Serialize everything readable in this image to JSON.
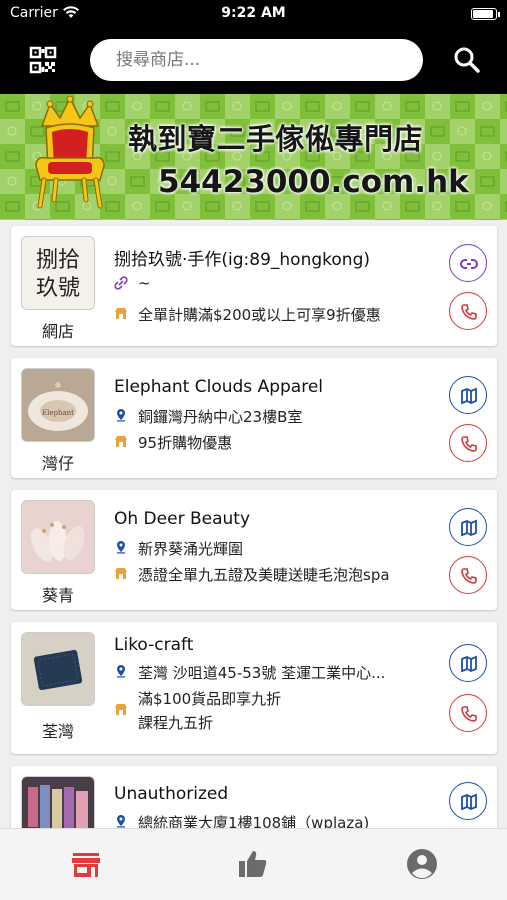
{
  "status_bar": {
    "carrier": "Carrier",
    "time": "9:22 AM",
    "battery_level": 1.0
  },
  "search": {
    "placeholder": "搜尋商店..."
  },
  "banner": {
    "title": "執到寶二手傢俬專門店",
    "url": "54423000.com.hk"
  },
  "shops": [
    {
      "name": "捌拾玖號·手作(ig:89_hongkong)",
      "district": "網店",
      "thumb_text": "捌拾玖號",
      "info_icon": "link-icon",
      "info": "~",
      "offer": "全單計購滿$200或以上可享9折優惠",
      "offer_line2": "",
      "action1": "link-icon"
    },
    {
      "name": "Elephant Clouds Apparel",
      "district": "灣仔",
      "thumb_text": "",
      "info_icon": "location-icon",
      "info": "銅鑼灣丹納中心23樓B室",
      "offer": "95折購物優惠",
      "offer_line2": "",
      "action1": "map-icon"
    },
    {
      "name": "Oh Deer Beauty",
      "district": "葵青",
      "thumb_text": "",
      "info_icon": "location-icon",
      "info": "新界葵涌光輝圍",
      "offer": "憑證全單九五證及美睫送睫毛泡泡spa",
      "offer_line2": "",
      "action1": "map-icon"
    },
    {
      "name": "Liko-craft",
      "district": "荃灣",
      "thumb_text": "",
      "info_icon": "location-icon",
      "info": "荃灣 沙咀道45-53號 荃運工業中心...",
      "offer": "滿$100貨品即享九折",
      "offer_line2": "課程九五折",
      "action1": "map-icon"
    },
    {
      "name": "Unauthorized",
      "district": "",
      "thumb_text": "",
      "info_icon": "location-icon",
      "info": "總統商業大廈1樓108鋪（wplaza)",
      "offer": "",
      "offer_line2": "",
      "action1": "map-icon"
    }
  ],
  "tabs": [
    {
      "name": "shops",
      "icon": "store-icon",
      "active": true
    },
    {
      "name": "favourites",
      "icon": "thumbs-up-icon",
      "active": false
    },
    {
      "name": "account",
      "icon": "account-icon",
      "active": false
    }
  ],
  "colors": {
    "map": "#1f4fa8",
    "link": "#7b3fb3",
    "phone": "#d13a3a",
    "offer_icon": "#e8a33a",
    "active_tab": "#e23b3b",
    "inactive_tab": "#6b6b6b",
    "banner_green": "#8cc63f"
  }
}
